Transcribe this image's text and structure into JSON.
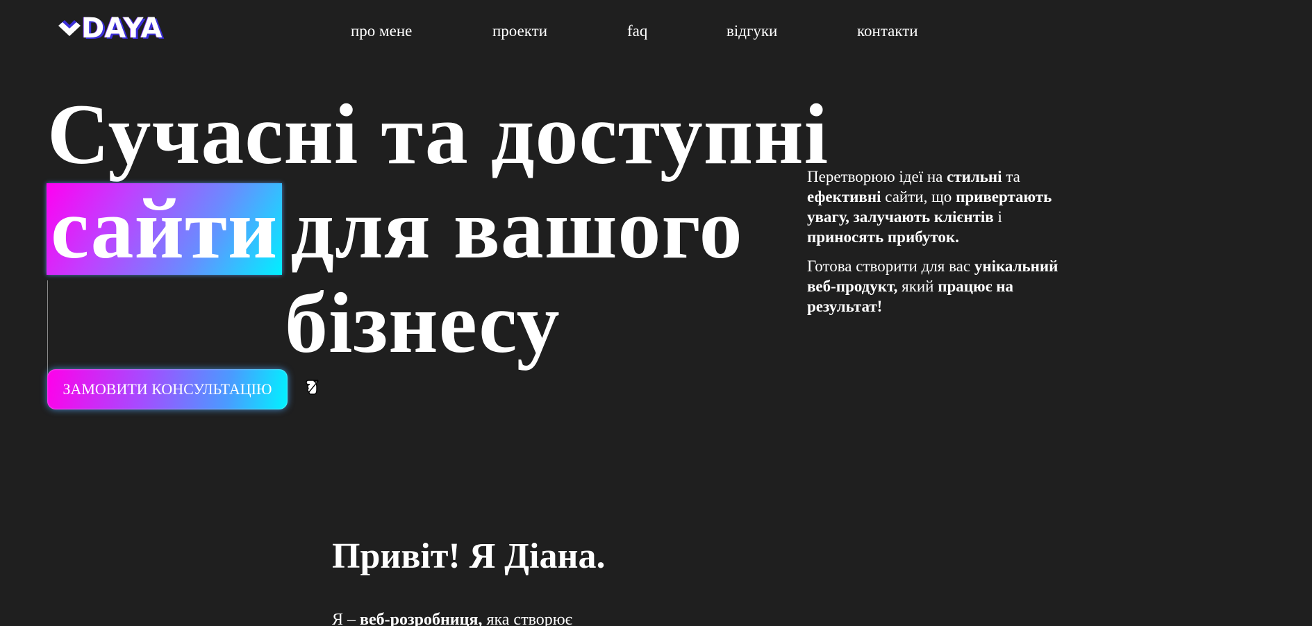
{
  "header": {
    "logo_text": "DAYA",
    "nav": [
      {
        "label": "про мене"
      },
      {
        "label": "проекти"
      },
      {
        "label": "faq"
      },
      {
        "label": "відгуки"
      },
      {
        "label": "контакти"
      }
    ]
  },
  "hero": {
    "title_line1": "Сучасні та доступні",
    "title_highlight": "сайти",
    "title_line2_rest": "для вашого",
    "title_line3": "бізнесу",
    "cta_label": "ЗАМОВИТИ КОНСУЛЬТАЦІЮ",
    "cta_icon": "pointing-hand-icon"
  },
  "side": {
    "p1": [
      {
        "text": "Перетворюю ідеї на ",
        "bold": false
      },
      {
        "text": "стильні",
        "bold": true
      },
      {
        "text": " та ",
        "bold": false
      },
      {
        "text": "ефективні",
        "bold": true
      },
      {
        "text": " сайти, що ",
        "bold": false
      },
      {
        "text": "привертають увагу, залучають клієнтів",
        "bold": true
      },
      {
        "text": " і ",
        "bold": false
      },
      {
        "text": "приносять прибуток.",
        "bold": true
      }
    ],
    "p2": [
      {
        "text": "Готова створити для вас ",
        "bold": false
      },
      {
        "text": "унікальний веб-продукт,",
        "bold": true
      },
      {
        "text": " який ",
        "bold": false
      },
      {
        "text": "працює на результат!",
        "bold": true
      }
    ]
  },
  "about": {
    "title": "Привіт! Я Діана.",
    "text_parts": [
      {
        "text": "Я – ",
        "bold": false
      },
      {
        "text": "веб-розробниця,",
        "bold": true
      },
      {
        "text": " яка створює",
        "bold": false
      }
    ]
  },
  "colors": {
    "background": "#1f1f1f",
    "text": "#ffffff",
    "gradient_start": "#ff00f2",
    "gradient_end": "#00f0ff"
  }
}
